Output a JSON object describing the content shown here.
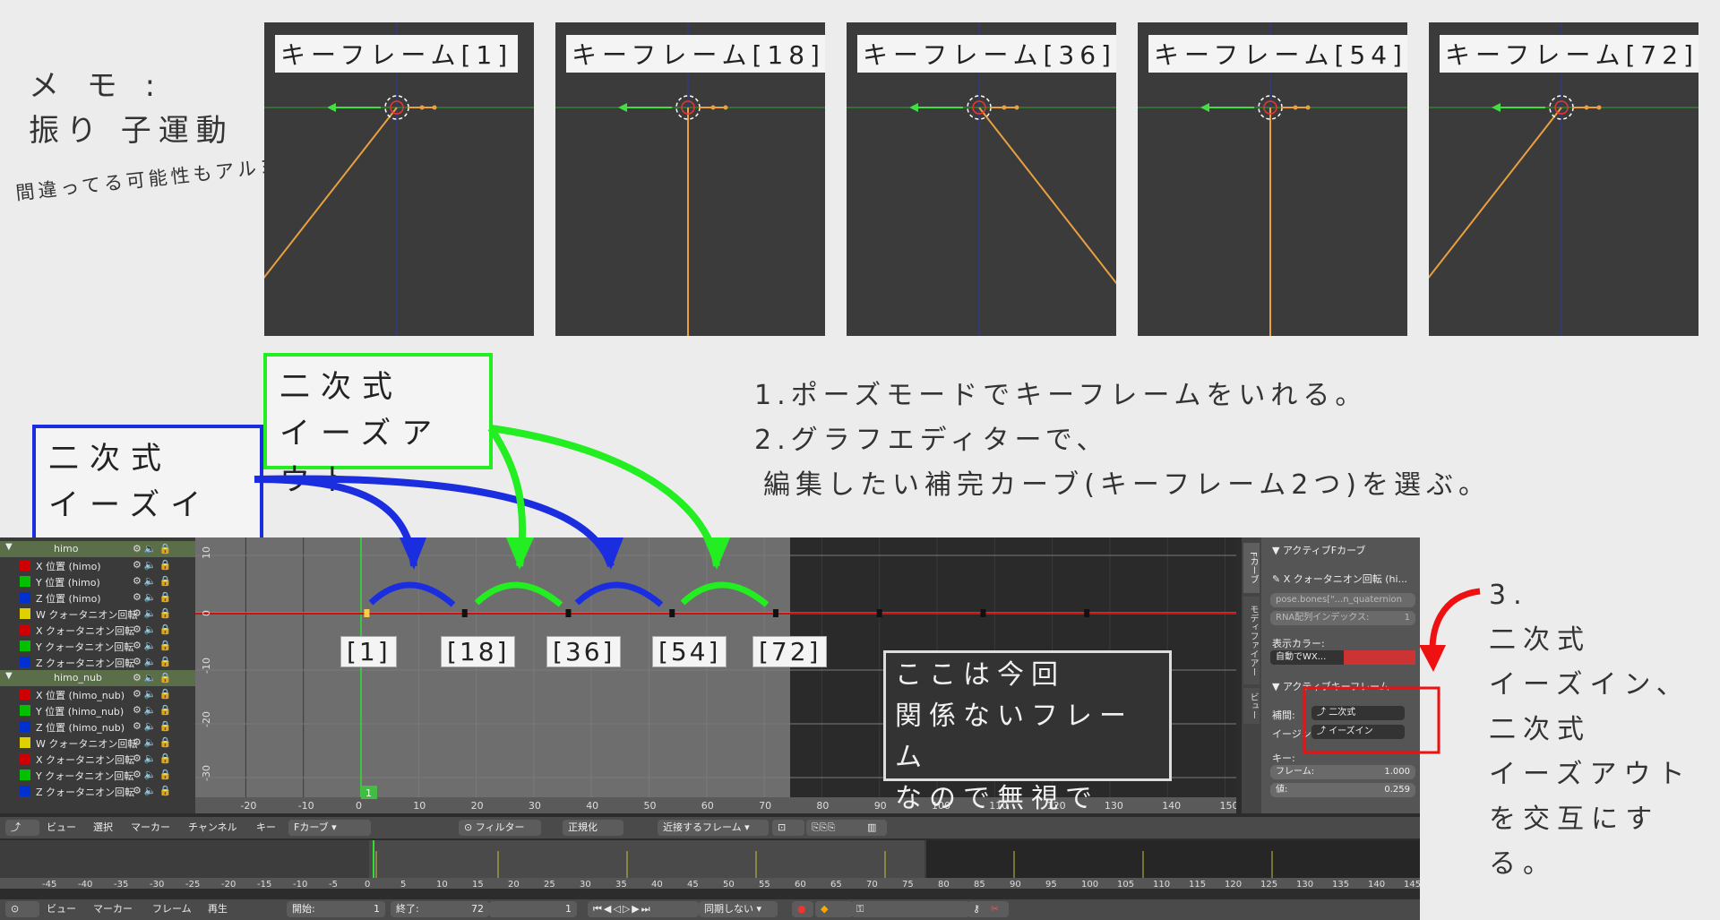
{
  "memo": {
    "title1": "メ モ :",
    "title2": "振り 子運動",
    "note": "間違ってる可能性もアルヨ"
  },
  "keyframes": [
    {
      "label": "キーフレーム[1]",
      "angle": -38
    },
    {
      "label": "キーフレーム[18]",
      "angle": 0
    },
    {
      "label": "キーフレーム[36]",
      "angle": 38
    },
    {
      "label": "キーフレーム[54]",
      "angle": 0
    },
    {
      "label": "キーフレーム[72]",
      "angle": -38
    }
  ],
  "easing_labels": {
    "ease_out_1": "二次式",
    "ease_out_2": "イーズアウト",
    "ease_in_1": "二次式",
    "ease_in_2": "イーズイン"
  },
  "instructions": {
    "step1": "1.ポーズモードでキーフレームをいれる。",
    "step2a": "2.グラフエディターで、",
    "step2b": "編集したい補完カーブ(キーフレーム2つ)を選ぶ。",
    "step3": [
      "3.",
      "二次式",
      "イーズイン、",
      "二次式",
      "イーズアウト",
      "を交互にする。"
    ]
  },
  "frame_labels": [
    "[1]",
    "[18]",
    "[36]",
    "[54]",
    "[72]"
  ],
  "ignore_note": [
    "ここは今回",
    "関係ないフレーム",
    "なので無視で"
  ],
  "outliner": {
    "items": [
      {
        "label": "himo",
        "color": "",
        "group": true
      },
      {
        "label": "X 位置 (himo)",
        "color": "#d00000"
      },
      {
        "label": "Y 位置 (himo)",
        "color": "#00c000"
      },
      {
        "label": "Z 位置 (himo)",
        "color": "#0030d0"
      },
      {
        "label": "W クォータニオン回転",
        "color": "#e0d000"
      },
      {
        "label": "X クォータニオン回転",
        "color": "#d00000"
      },
      {
        "label": "Y クォータニオン回転",
        "color": "#00c000"
      },
      {
        "label": "Z クォータニオン回転",
        "color": "#0030d0"
      },
      {
        "label": "himo_nub",
        "color": "",
        "group": true
      },
      {
        "label": "X 位置 (himo_nub)",
        "color": "#d00000"
      },
      {
        "label": "Y 位置 (himo_nub)",
        "color": "#00c000"
      },
      {
        "label": "Z 位置 (himo_nub)",
        "color": "#0030d0"
      },
      {
        "label": "W クォータニオン回転",
        "color": "#e0d000"
      },
      {
        "label": "X クォータニオン回転",
        "color": "#d00000"
      },
      {
        "label": "Y クォータニオン回転",
        "color": "#00c000"
      },
      {
        "label": "Z クォータニオン回転",
        "color": "#0030d0"
      }
    ]
  },
  "graph": {
    "y_ticks": [
      "10",
      "0",
      "-10",
      "-20",
      "-30"
    ],
    "x_ticks": [
      "-20",
      "-10",
      "0",
      "10",
      "20",
      "30",
      "40",
      "50",
      "60",
      "70",
      "80",
      "90",
      "100",
      "110",
      "120",
      "130",
      "140",
      "150"
    ],
    "current_frame": "1"
  },
  "props": {
    "section1": "▼ アクティブFカーブ",
    "curve_name": "X クォータニオン回転 (hi...",
    "data_path": "pose.bones[\"...n_quaternion",
    "rna_index": "RNA配列インデックス:",
    "rna_value": "1",
    "display_color": "表示カラー:",
    "color_mode": "自動でWX...",
    "section2": "▼ アクティブキーフレーム",
    "interp_label": "補間:",
    "interp_value": "二次式",
    "easing_label": "イージン",
    "easing_value": "イーズイン",
    "key_label": "キー:",
    "frame_label": "フレーム:",
    "frame_value": "1.000",
    "value_label": "値:",
    "value_value": "0.259",
    "tabs": [
      "Fカーブ",
      "モディファイアー",
      "ビュー"
    ]
  },
  "header1": {
    "view": "ビュー",
    "select": "選択",
    "marker": "マーカー",
    "channel": "チャンネル",
    "key": "キー",
    "mode": "Fカーブ",
    "filter": "フィルター",
    "normalize": "正規化",
    "snap": "近接するフレーム"
  },
  "timeline": {
    "ticks": [
      "-45",
      "-40",
      "-35",
      "-30",
      "-25",
      "-20",
      "-15",
      "-10",
      "-5",
      "0",
      "5",
      "10",
      "15",
      "20",
      "25",
      "30",
      "35",
      "40",
      "45",
      "50",
      "55",
      "60",
      "65",
      "70",
      "75",
      "80",
      "85",
      "90",
      "95",
      "100",
      "105",
      "110",
      "115",
      "120",
      "125",
      "130",
      "135",
      "140",
      "145"
    ]
  },
  "header2": {
    "view": "ビュー",
    "marker": "マーカー",
    "frame": "フレーム",
    "play": "再生",
    "start_label": "開始:",
    "start_value": "1",
    "end_label": "終了:",
    "end_value": "72",
    "current": "1",
    "sync": "同期しない"
  },
  "colors": {
    "accent_green": "#22ee22",
    "accent_blue": "#1a2ee0",
    "accent_red": "#ee1111"
  }
}
